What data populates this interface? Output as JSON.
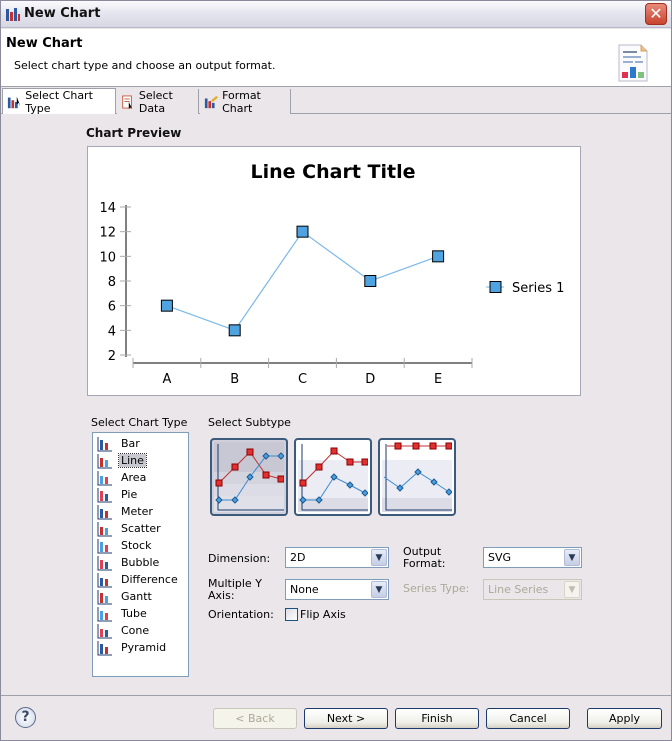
{
  "window": {
    "title": "New Chart",
    "close_icon": "close-icon"
  },
  "header": {
    "title": "New Chart",
    "description": "Select chart type and choose an output format.",
    "icon": "chart-document-icon"
  },
  "tabs": [
    {
      "label": "Select Chart Type",
      "icon": "chart-type-icon",
      "active": true
    },
    {
      "label": "Select Data",
      "icon": "select-data-icon",
      "active": false
    },
    {
      "label": "Format Chart",
      "icon": "format-chart-icon",
      "active": false
    }
  ],
  "preview": {
    "label": "Chart Preview",
    "chart_data": {
      "type": "line",
      "title": "Line Chart Title",
      "categories": [
        "A",
        "B",
        "C",
        "D",
        "E"
      ],
      "series": [
        {
          "name": "Series 1",
          "values": [
            6,
            4,
            12,
            8,
            10
          ],
          "color": "#4fa3e0"
        }
      ],
      "xlabel": "",
      "ylabel": "",
      "ylim": [
        2,
        14
      ],
      "yticks": [
        2,
        4,
        6,
        8,
        10,
        12,
        14
      ],
      "legend": "right",
      "grid": false,
      "marker": "square"
    }
  },
  "chart_types": {
    "label": "Select Chart Type",
    "selected": "Line",
    "items": [
      {
        "label": "Bar",
        "icon": "bar-chart-icon"
      },
      {
        "label": "Line",
        "icon": "line-chart-icon"
      },
      {
        "label": "Area",
        "icon": "area-chart-icon"
      },
      {
        "label": "Pie",
        "icon": "pie-chart-icon"
      },
      {
        "label": "Meter",
        "icon": "meter-chart-icon"
      },
      {
        "label": "Scatter",
        "icon": "scatter-chart-icon"
      },
      {
        "label": "Stock",
        "icon": "stock-chart-icon"
      },
      {
        "label": "Bubble",
        "icon": "bubble-chart-icon"
      },
      {
        "label": "Difference",
        "icon": "difference-chart-icon"
      },
      {
        "label": "Gantt",
        "icon": "gantt-chart-icon"
      },
      {
        "label": "Tube",
        "icon": "tube-chart-icon"
      },
      {
        "label": "Cone",
        "icon": "cone-chart-icon"
      },
      {
        "label": "Pyramid",
        "icon": "pyramid-chart-icon"
      }
    ]
  },
  "subtypes": {
    "label": "Select Subtype",
    "items": [
      {
        "name": "overlay-line",
        "selected": true
      },
      {
        "name": "stacked-line",
        "selected": false
      },
      {
        "name": "percent-stacked-line",
        "selected": false
      }
    ]
  },
  "options": {
    "dimension": {
      "label": "Dimension:",
      "value": "2D"
    },
    "multiple_y_axis": {
      "label": "Multiple Y Axis:",
      "value": "None"
    },
    "orientation": {
      "label": "Orientation:",
      "checkbox_label": "Flip Axis",
      "checked": false
    },
    "output_format": {
      "label": "Output Format:",
      "value": "SVG"
    },
    "series_type": {
      "label": "Series Type:",
      "value": "Line Series",
      "disabled": true
    }
  },
  "footer": {
    "help_icon": "help-icon",
    "back": "< Back",
    "next": "Next >",
    "finish": "Finish",
    "cancel": "Cancel",
    "apply": "Apply"
  }
}
